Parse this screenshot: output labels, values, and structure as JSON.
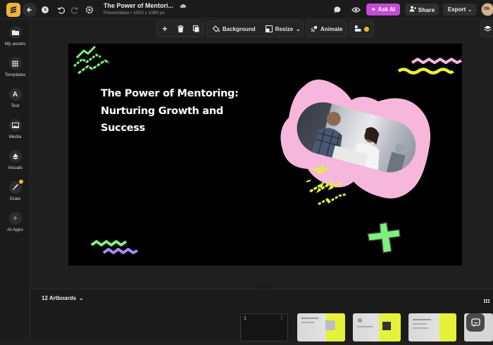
{
  "header": {
    "title": "The Power of Mentori...",
    "subtitle": "Presentation • 1920 x 1080 px",
    "ask_ai": "Ask AI",
    "share": "Share",
    "export": "Export",
    "avatar_initials": "Ob"
  },
  "sidebar": {
    "items": [
      {
        "label": "My assets",
        "icon": "folder-icon"
      },
      {
        "label": "Templates",
        "icon": "grid-icon"
      },
      {
        "label": "Text",
        "icon": "text-icon"
      },
      {
        "label": "Media",
        "icon": "image-icon"
      },
      {
        "label": "Visuals",
        "icon": "shapes-icon"
      },
      {
        "label": "Draw",
        "icon": "brush-icon"
      },
      {
        "label": "AI Apps",
        "icon": "sparkle-icon"
      }
    ]
  },
  "toolbar": {
    "background": "Background",
    "resize": "Resize",
    "animate": "Animate"
  },
  "slide": {
    "title_line1": "The Power of Mentoring:",
    "title_line2": "Nurturing Growth and",
    "title_line3": "Success"
  },
  "bottom": {
    "artboards_label": "12 Artboards",
    "current_page": "1"
  },
  "colors": {
    "accent_ai": "#c54bd6",
    "pink_blob": "#f7b6dc",
    "lime": "#e4f23a",
    "green": "#7ef07e",
    "purple": "#a78bfa"
  }
}
